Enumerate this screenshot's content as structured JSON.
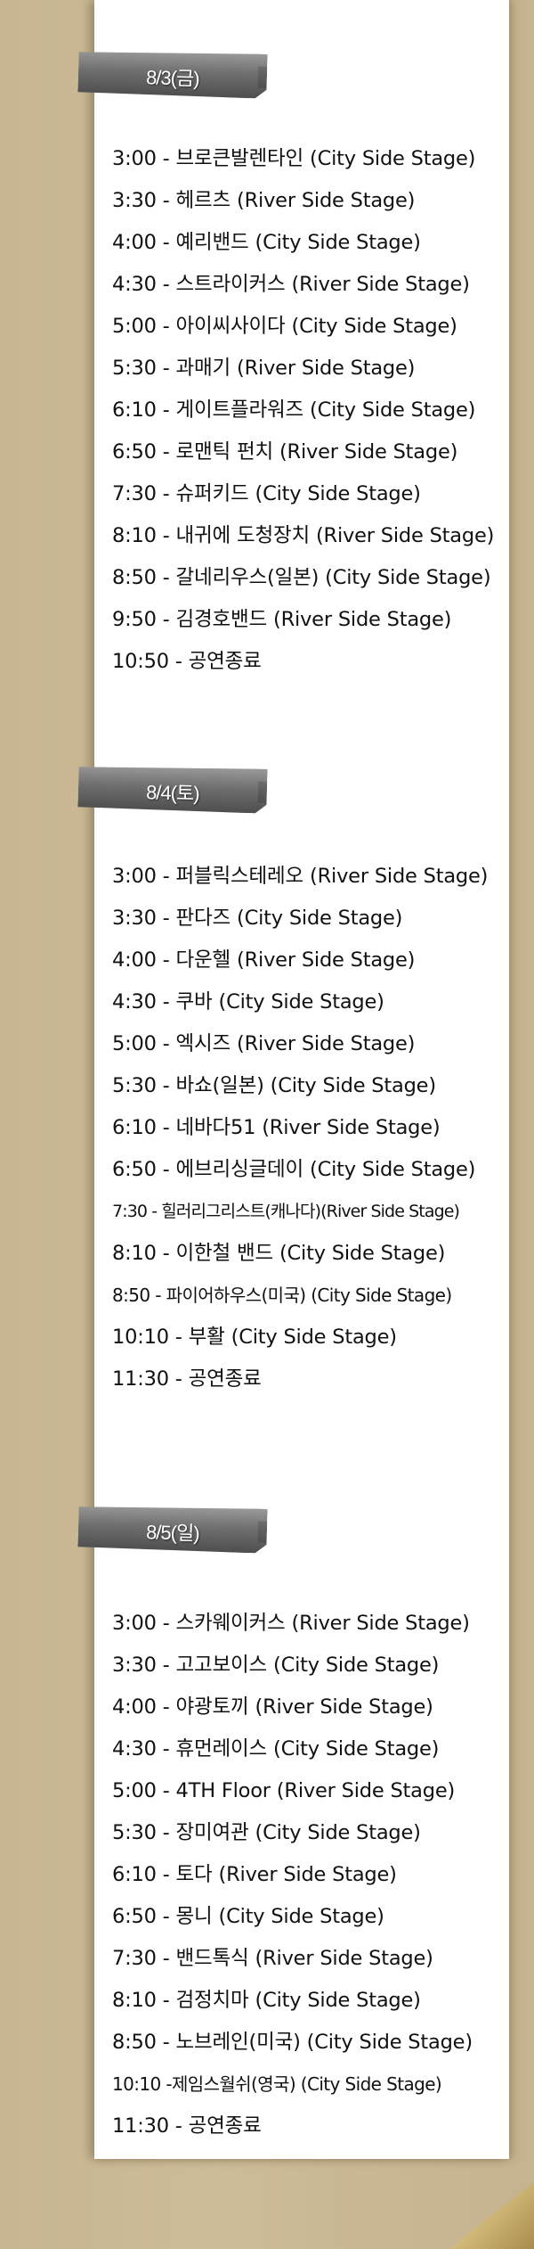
{
  "days": [
    {
      "date_label": "8/3(금)",
      "schedule": [
        "3:00 - 브로큰발렌타인 (City Side Stage)",
        "3:30 - 헤르츠 (River Side Stage)",
        "4:00 - 예리밴드 (City Side Stage)",
        "4:30 - 스트라이커스 (River Side Stage)",
        "5:00 - 아이씨사이다 (City Side Stage)",
        "5:30 - 과매기 (River Side Stage)",
        "6:10 - 게이트플라워즈 (City Side Stage)",
        "6:50 - 로맨틱 펀치 (River Side Stage)",
        "7:30 - 슈퍼키드 (City Side Stage)",
        "8:10 - 내귀에 도청장치 (River Side Stage)",
        "8:50 - 갈네리우스(일본) (City Side Stage)",
        "9:50 - 김경호밴드 (River Side Stage)",
        "10:50 - 공연종료"
      ]
    },
    {
      "date_label": "8/4(토)",
      "schedule": [
        "3:00 - 퍼블릭스테레오 (River Side Stage)",
        "3:30 - 판다즈 (City Side Stage)",
        "4:00 - 다운헬 (River Side Stage)",
        "4:30 - 쿠바 (City Side Stage)",
        "5:00 - 엑시즈 (River Side Stage)",
        "5:30 - 바쇼(일본) (City Side Stage)",
        "6:10 - 네바다51 (River Side Stage)",
        "6:50 - 에브리싱글데이 (City Side Stage)",
        "7:30 - 힐러리그리스트(캐나다)(River Side Stage)",
        "8:10 - 이한철 밴드 (City Side Stage)",
        "8:50 - 파이어하우스(미국) (City Side Stage)",
        "10:10 - 부활 (City Side Stage)",
        "11:30 - 공연종료"
      ]
    },
    {
      "date_label": "8/5(일)",
      "schedule": [
        "3:00 - 스카웨이커스 (River Side Stage)",
        "3:30 - 고고보이스 (City Side Stage)",
        "4:00 - 야광토끼 (River Side Stage)",
        "4:30 - 휴먼레이스 (City Side Stage)",
        "5:00 - 4TH Floor (River Side Stage)",
        "5:30 - 장미여관 (City Side Stage)",
        "6:10 - 토다 (River Side Stage)",
        "6:50 - 몽니 (City Side Stage)",
        "7:30 - 밴드톡식 (River Side Stage)",
        "8:10 - 검정치마 (City Side Stage)",
        "8:50 - 노브레인(미국) (City Side Stage)",
        "10:10 -제임스월쉬(영국) (City Side Stage)",
        "11:30 - 공연종료"
      ]
    }
  ]
}
